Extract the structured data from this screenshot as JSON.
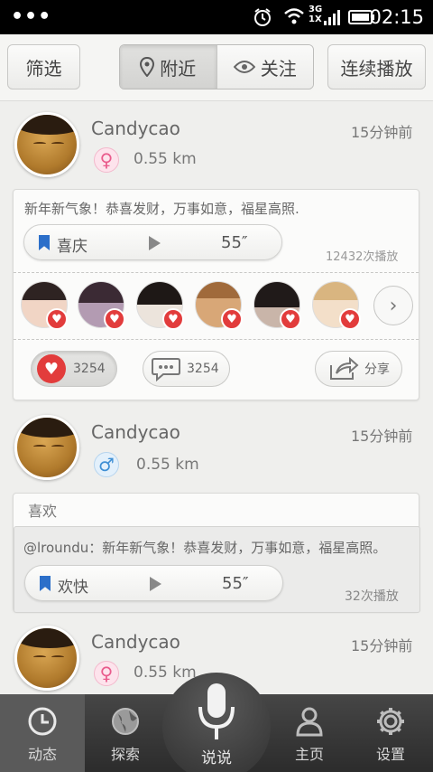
{
  "status": {
    "time": "02:15",
    "network": "3G\n1X"
  },
  "toolbar": {
    "filter_label": "筛选",
    "nearby_label": "附近",
    "follow_label": "关注",
    "continuous_label": "连续播放"
  },
  "posts": [
    {
      "user": "Candycao",
      "time_ago": "15分钟前",
      "gender": "♀",
      "distance": "0.55 km",
      "message": "新年新气象！恭喜发财，万事如意，福星高照.",
      "track_label": "喜庆",
      "duration": "55″",
      "plays": "12432次播放",
      "like_count": "3254",
      "comment_count": "3254",
      "share_label": "分享"
    },
    {
      "user": "Candycao",
      "time_ago": "15分钟前",
      "gender": "♂",
      "distance": "0.55 km",
      "section_label": "喜欢",
      "message": "@lroundu：新年新气象！恭喜发财，万事如意，福星高照。",
      "track_label": "欢快",
      "duration": "55″",
      "plays": "32次播放"
    },
    {
      "user": "Candycao",
      "time_ago": "15分钟前",
      "gender": "♀",
      "distance": "0.55 km"
    }
  ],
  "nav": {
    "feed": "动态",
    "explore": "探索",
    "speak": "说说",
    "home": "主页",
    "settings": "设置"
  },
  "colors": {
    "accent_red": "#e23c3c",
    "bookmark_blue": "#2c6fc9",
    "female_pink": "#e95b8c",
    "male_blue": "#3f8fd4"
  }
}
